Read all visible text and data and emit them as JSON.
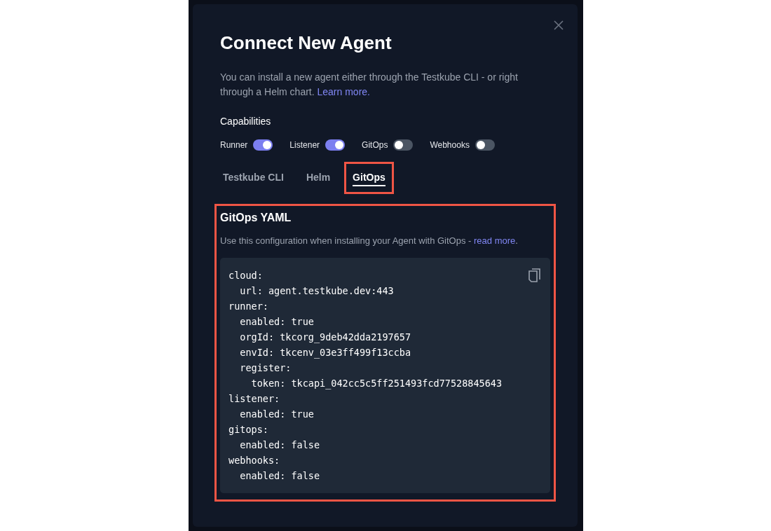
{
  "dialog": {
    "title": "Connect New Agent",
    "description": "You can install a new agent either through the Testkube CLI - or right through a Helm chart.",
    "description_link": "Learn more.",
    "capabilities_label": "Capabilities",
    "capabilities": [
      {
        "label": "Runner",
        "on": true
      },
      {
        "label": "Listener",
        "on": true
      },
      {
        "label": "GitOps",
        "on": false
      },
      {
        "label": "Webhooks",
        "on": false
      }
    ],
    "tabs": [
      {
        "label": "Testkube CLI",
        "selected": false,
        "highlighted": false
      },
      {
        "label": "Helm",
        "selected": false,
        "highlighted": false
      },
      {
        "label": "GitOps",
        "selected": true,
        "highlighted": true
      }
    ],
    "section": {
      "heading": "GitOps YAML",
      "highlighted": true,
      "description": "Use this configuration when installing your Agent with GitOps - ",
      "link": "read more",
      "trailing": ".",
      "code_lines": [
        "cloud:",
        "  url: agent.testkube.dev:443",
        "runner:",
        "  enabled: true",
        "  orgId: tkcorg_9deb42dda2197657",
        "  envId: tkcenv_03e3ff499f13ccba",
        "  register:",
        "    token: tkcapi_042cc5c5ff251493fcd77528845643",
        "listener:",
        "  enabled: true",
        "gitops:",
        "  enabled: false",
        "webhooks:",
        "  enabled: false"
      ]
    }
  }
}
